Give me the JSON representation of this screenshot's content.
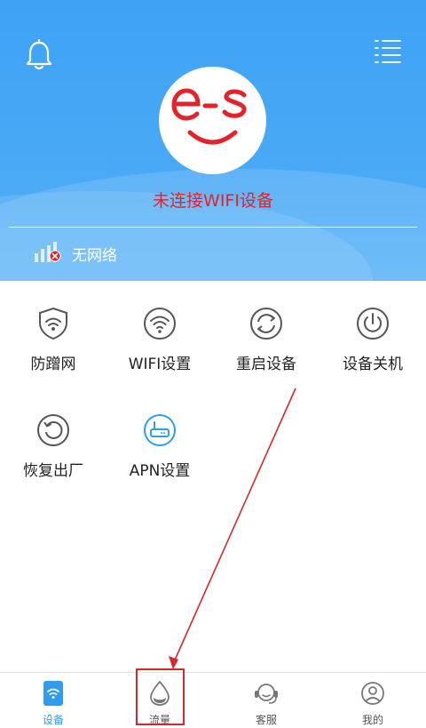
{
  "header": {
    "logo_text": "e-s",
    "connection_status": "未连接WIFI设备",
    "network_status": "无网络",
    "status_color": "#e2242a",
    "background_color": "#45a6f5"
  },
  "icons": {
    "bell": "bell-icon",
    "menu": "menu-list-icon",
    "signal": "signal-no-network-icon"
  },
  "functions": [
    {
      "label": "防蹭网",
      "icon": "wifi-shield-icon"
    },
    {
      "label": "WIFI设置",
      "icon": "wifi-icon"
    },
    {
      "label": "重启设备",
      "icon": "restart-icon"
    },
    {
      "label": "设备关机",
      "icon": "power-icon"
    },
    {
      "label": "恢复出厂",
      "icon": "factory-reset-icon"
    },
    {
      "label": "APN设置",
      "icon": "router-icon"
    }
  ],
  "bottom_nav": [
    {
      "label": "设备",
      "icon": "device-icon",
      "active": true
    },
    {
      "label": "流量",
      "icon": "data-drop-icon",
      "active": false
    },
    {
      "label": "客服",
      "icon": "headset-icon",
      "active": false
    },
    {
      "label": "我的",
      "icon": "profile-icon",
      "active": false
    }
  ],
  "colors": {
    "accent": "#2f9cee",
    "annotation": "#d8262a"
  }
}
